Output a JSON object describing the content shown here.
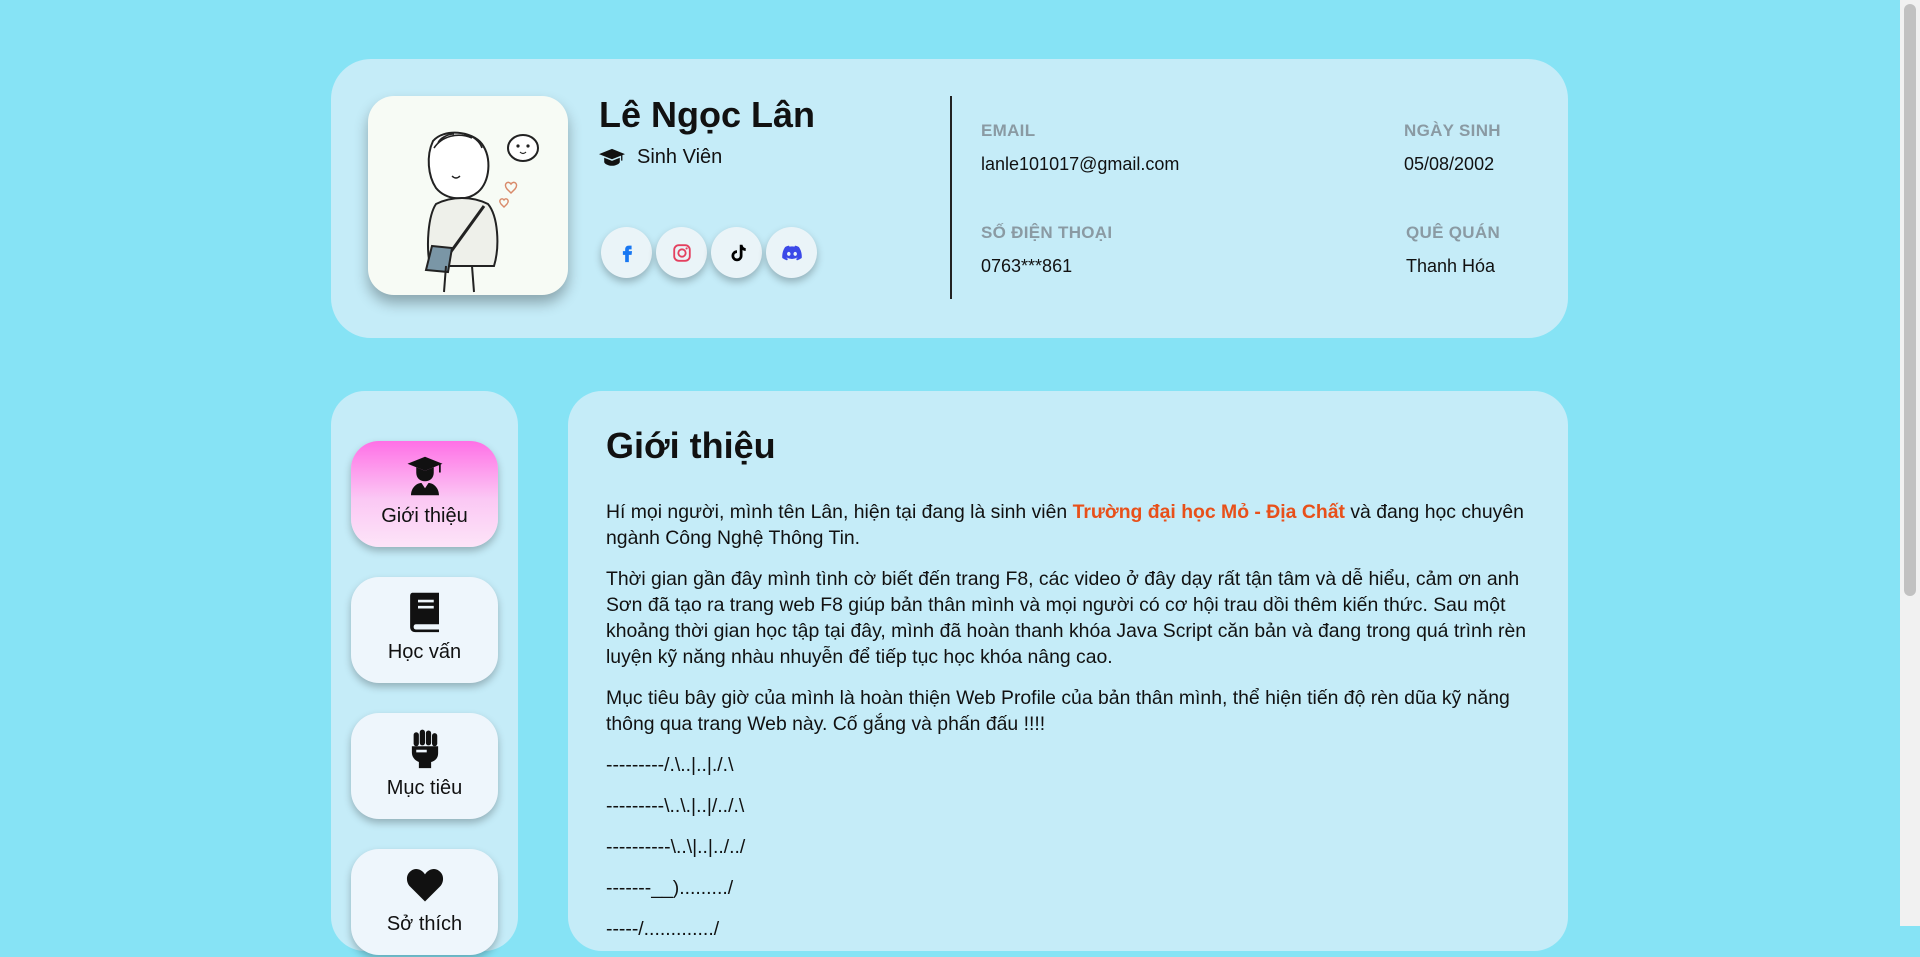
{
  "profile": {
    "name": "Lê Ngọc Lân",
    "role": "Sinh Viên",
    "info": {
      "email_label": "EMAIL",
      "email_value": "lanle101017@gmail.com",
      "dob_label": "NGÀY SINH",
      "dob_value": "05/08/2002",
      "phone_label": "SỐ ĐIỆN THOẠI",
      "phone_value": "0763***861",
      "hometown_label": "QUÊ QUÁN",
      "hometown_value": "Thanh Hóa"
    },
    "socials": [
      {
        "icon": "facebook-icon",
        "color": "#1877f2"
      },
      {
        "icon": "instagram-icon",
        "color": "#e4405f"
      },
      {
        "icon": "tiktok-icon",
        "color": "#000000"
      },
      {
        "icon": "discord-icon",
        "color": "#3b49e8"
      }
    ]
  },
  "nav": {
    "items": [
      {
        "label": "Giới thiệu",
        "icon": "graduate-icon",
        "active": true
      },
      {
        "label": "Học vấn",
        "icon": "book-icon"
      },
      {
        "label": "Mục tiêu",
        "icon": "fist-icon"
      },
      {
        "label": "Sở thích",
        "icon": "heart-icon"
      }
    ]
  },
  "content": {
    "title": "Giới thiệu",
    "p1_before": "Hí mọi người, mình tên Lân, hiện tại đang là sinh viên ",
    "p1_highlight": "Trường đại học Mỏ - Địa Chất",
    "p1_after": " và đang học chuyên ngành Công Nghệ Thông Tin.",
    "p2": "Thời gian gần đây mình tình cờ biết đến trang F8, các video ở đây dạy rất tận tâm và dễ hiểu, cảm ơn anh Sơn đã tạo ra trang web F8 giúp bản thân mình và mọi người có cơ hội trau dồi thêm kiến thức. Sau một khoảng thời gian học tập tại đây, mình đã hoàn thanh khóa Java Script căn bản và đang trong quá trình rèn luyện kỹ năng nhàu nhuyễn để tiếp tục học khóa nâng cao.",
    "p3": "Mục tiêu bây giờ của mình là hoàn thiện Web Profile của bản thân mình, thể hiện tiến độ rèn dũa kỹ năng thông qua trang Web này. Cố gắng và phấn đấu !!!!",
    "ascii": [
      "---------/.\\..|..|./.\\",
      "---------\\..\\.|..|/../.\\",
      "----------\\..\\|..|../../",
      "-------__)........./",
      "-----/............./"
    ]
  },
  "colors": {
    "page_bg": "#86e3f5",
    "card_bg": "#c5ecf8",
    "highlight": "#e8501a",
    "active_nav_gradient_top": "#ff70e6"
  }
}
